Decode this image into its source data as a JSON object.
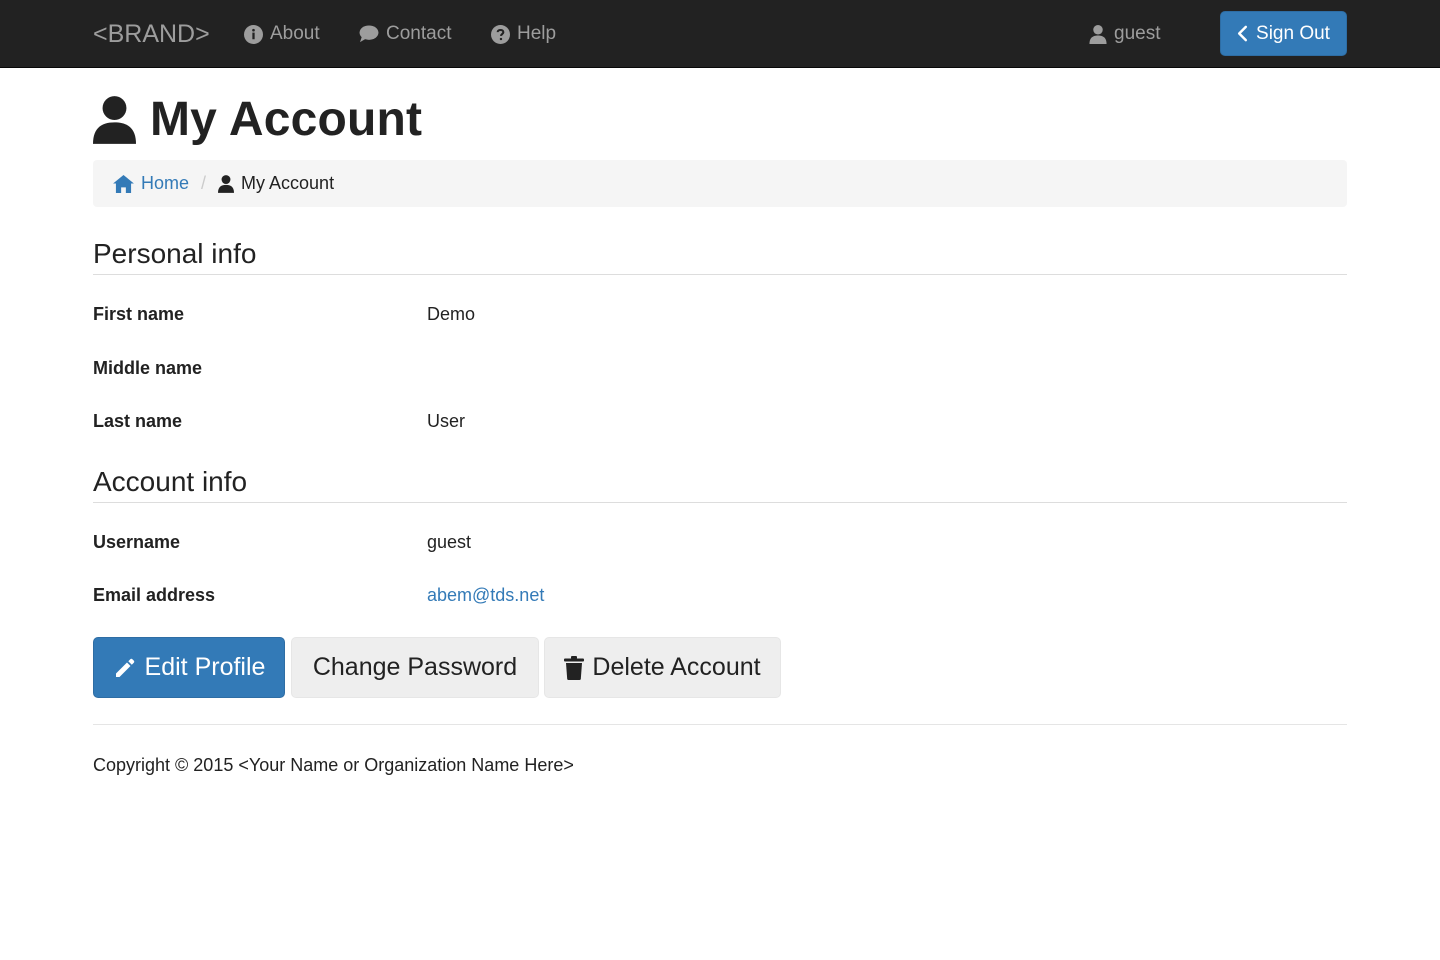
{
  "navbar": {
    "brand": "<BRAND>",
    "links": [
      {
        "label": "About",
        "icon": "info-icon"
      },
      {
        "label": "Contact",
        "icon": "comment-icon"
      },
      {
        "label": "Help",
        "icon": "question-icon"
      }
    ],
    "user": {
      "label": "guest",
      "icon": "user-icon"
    },
    "signout_label": "Sign Out"
  },
  "page": {
    "title": "My Account",
    "title_icon": "user-icon"
  },
  "breadcrumb": {
    "home_label": "Home",
    "separator": "/",
    "current_label": "My Account"
  },
  "personal_info": {
    "heading": "Personal info",
    "fields": [
      {
        "label": "First name",
        "value": "Demo"
      },
      {
        "label": "Middle name",
        "value": ""
      },
      {
        "label": "Last name",
        "value": "User"
      }
    ]
  },
  "account_info": {
    "heading": "Account info",
    "fields": [
      {
        "label": "Username",
        "value": "guest"
      },
      {
        "label": "Email address",
        "value": "abem@tds.net"
      }
    ]
  },
  "actions": {
    "edit_label": "Edit Profile",
    "change_password_label": "Change Password",
    "delete_label": "Delete Account"
  },
  "footer": {
    "copyright": "Copyright © 2015 <Your Name or Organization Name Here>"
  },
  "colors": {
    "navbar_bg": "#222222",
    "primary": "#337ab7",
    "link": "#337ab7",
    "breadcrumb_bg": "#f5f5f5",
    "button_default_bg": "#eeeeee"
  }
}
